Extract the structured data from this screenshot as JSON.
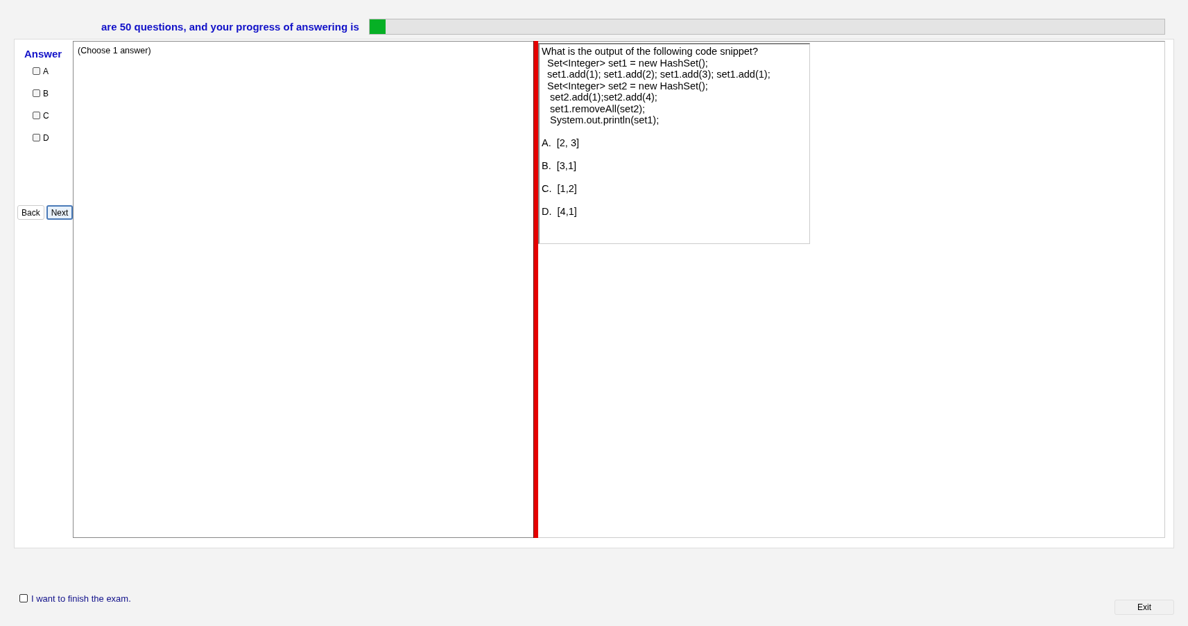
{
  "header": {
    "progress_text": "are 50 questions, and your progress of answering is",
    "progress": {
      "level": 0.02
    }
  },
  "answer_panel": {
    "title": "Answer",
    "options": [
      {
        "label": "A",
        "checked": false
      },
      {
        "label": "B",
        "checked": false
      },
      {
        "label": "C",
        "checked": false
      },
      {
        "label": "D",
        "checked": false
      }
    ],
    "buttons": [
      {
        "label": "Back",
        "focused": false
      },
      {
        "label": "Next",
        "focused": true
      }
    ]
  },
  "answer_area": {
    "hint": "(Choose 1 answer)"
  },
  "question": {
    "lines": [
      "What is the output of the following code snippet?",
      "  Set<Integer> set1 = new HashSet();",
      "  set1.add(1); set1.add(2); set1.add(3); set1.add(1);",
      "  Set<Integer> set2 = new HashSet();",
      "   set2.add(1);set2.add(4);",
      "   set1.removeAll(set2);",
      "   System.out.println(set1);"
    ],
    "choices": [
      "A.  [2, 3]",
      "B.  [3,1]",
      "C.  [1,2]",
      "D.  [4,1]"
    ]
  },
  "finish": {
    "label": "I want to finish the exam.",
    "checked": false
  },
  "exit_button": "Exit"
}
